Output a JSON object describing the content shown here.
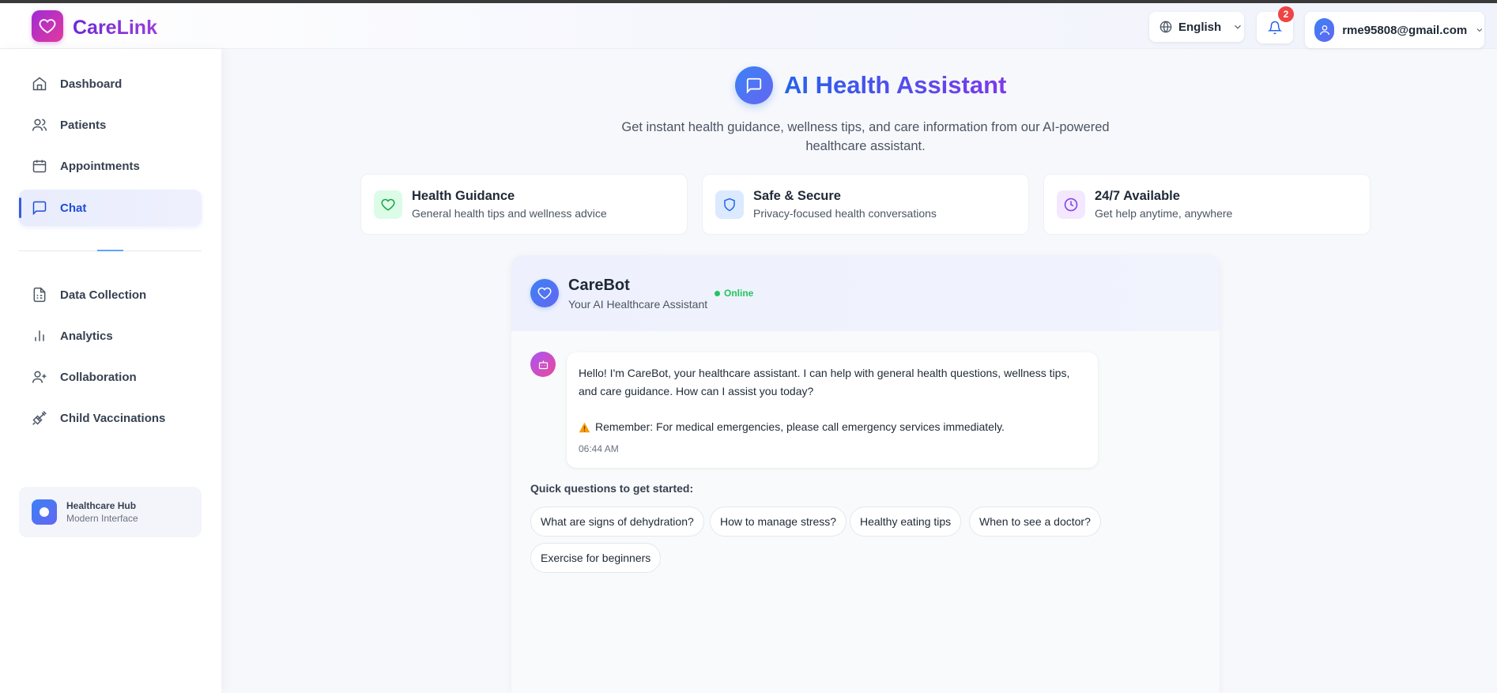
{
  "brand": {
    "name": "CareLink",
    "logo_icon": "heart-icon"
  },
  "header": {
    "language": "English",
    "notifications_count": "2",
    "user_email": "rme95808@gmail.com"
  },
  "sidebar": {
    "items": [
      {
        "label": "Dashboard",
        "icon": "home-icon"
      },
      {
        "label": "Patients",
        "icon": "users-icon"
      },
      {
        "label": "Appointments",
        "icon": "calendar-icon"
      },
      {
        "label": "Chat",
        "icon": "chat-icon",
        "active": true
      },
      {
        "label": "Data Collection",
        "icon": "document-icon"
      },
      {
        "label": "Analytics",
        "icon": "bar-chart-icon"
      },
      {
        "label": "Collaboration",
        "icon": "user-plus-icon"
      },
      {
        "label": "Child Vaccinations",
        "icon": "syringe-icon"
      }
    ],
    "hub": {
      "title": "Healthcare Hub",
      "subtitle": "Modern Interface"
    }
  },
  "main": {
    "title": "AI Health Assistant",
    "subtitle": "Get instant health guidance, wellness tips, and care information from our AI-powered healthcare assistant.",
    "features": [
      {
        "title": "Health Guidance",
        "subtitle": "General health tips and wellness advice",
        "icon": "heart-icon",
        "color": "#16a34a",
        "bg": "#dcfce7"
      },
      {
        "title": "Safe & Secure",
        "subtitle": "Privacy-focused health conversations",
        "icon": "shield-icon",
        "color": "#2563eb",
        "bg": "#dbeafe"
      },
      {
        "title": "24/7 Available",
        "subtitle": "Get help anytime, anywhere",
        "icon": "clock-icon",
        "color": "#7c3aed",
        "bg": "#f3e8ff"
      }
    ]
  },
  "chat": {
    "bot_name": "CareBot",
    "bot_role": "Your AI Healthcare Assistant",
    "status": "Online",
    "message": {
      "text": "Hello! I'm CareBot, your healthcare assistant. I can help with general health questions, wellness tips, and care guidance. How can I assist you today?",
      "warning": "Remember: For medical emergencies, please call emergency services immediately.",
      "time": "06:44 AM"
    },
    "quick_label": "Quick questions to get started:",
    "quick_questions": [
      "What are signs of dehydration?",
      "How to manage stress?",
      "Healthy eating tips",
      "When to see a doctor?",
      "Exercise for beginners"
    ]
  },
  "colors": {
    "accent": "#3b5bdb",
    "brand": "#7c3aed",
    "online": "#22c55e",
    "badge": "#ef4444"
  }
}
